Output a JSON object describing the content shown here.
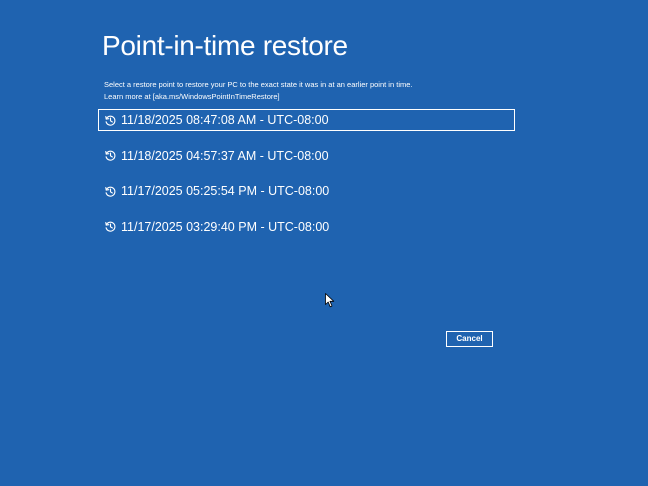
{
  "page": {
    "title": "Point-in-time restore",
    "description_line1": "Select a restore point to restore your PC to the exact state it was in at an earlier point in time.",
    "description_line2": "Learn more at [aka.ms/WindowsPointInTimeRestore]"
  },
  "restore_points": [
    {
      "label": "11/18/2025 08:47:08 AM - UTC-08:00",
      "icon": "history-icon",
      "selected": true
    },
    {
      "label": "11/18/2025 04:57:37 AM - UTC-08:00",
      "icon": "history-icon",
      "selected": false
    },
    {
      "label": "11/17/2025 05:25:54 PM - UTC-08:00",
      "icon": "history-icon",
      "selected": false
    },
    {
      "label": "11/17/2025 03:29:40 PM - UTC-08:00",
      "icon": "history-icon",
      "selected": false
    }
  ],
  "buttons": {
    "cancel_label": "Cancel"
  },
  "colors": {
    "background": "#1F63B0",
    "text": "#FFFFFF",
    "selection_border": "#FFFFFF"
  }
}
